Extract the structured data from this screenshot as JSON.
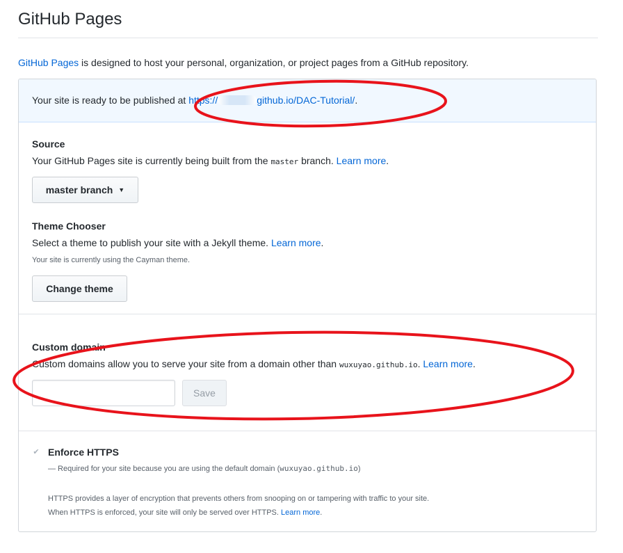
{
  "page": {
    "title": "GitHub Pages",
    "intro_link": "GitHub Pages",
    "intro_text": " is designed to host your personal, organization, or project pages from a GitHub repository."
  },
  "flash": {
    "text": "Your site is ready to be published at ",
    "url_prefix": "https://",
    "url_suffix": "github.io/DAC-Tutorial/",
    "end": "."
  },
  "source": {
    "heading": "Source",
    "desc_prefix": "Your GitHub Pages site is currently being built from the ",
    "branch_code": "master",
    "desc_suffix": " branch. ",
    "learn_more": "Learn more",
    "end": ".",
    "dropdown_label": "master branch"
  },
  "theme": {
    "heading": "Theme Chooser",
    "desc": "Select a theme to publish your site with a Jekyll theme. ",
    "learn_more": "Learn more",
    "end": ".",
    "note_prefix": "Your site is currently using the ",
    "theme_name": "Cayman",
    "note_suffix": " theme.",
    "button_label": "Change theme"
  },
  "domain": {
    "heading": "Custom domain",
    "desc_prefix": "Custom domains allow you to serve your site from a domain other than ",
    "default_domain": "wuxuyao.github.io",
    "desc_suffix": ". ",
    "learn_more": "Learn more",
    "end": ".",
    "input_value": "",
    "input_placeholder": "",
    "save_label": "Save"
  },
  "https": {
    "label": "Enforce HTTPS",
    "note_prefix": "— Required for your site because you are using the default domain (",
    "note_domain": "wuxuyao.github.io",
    "note_suffix": ")",
    "info_line1": "HTTPS provides a layer of encryption that prevents others from snooping on or tampering with traffic to your site.",
    "info_line2": "When HTTPS is enforced, your site will only be served over HTTPS. ",
    "learn_more": "Learn more",
    "end": "."
  },
  "colors": {
    "link": "#0366d6",
    "flash_bg": "#f1f8ff",
    "annotation": "#e8131b"
  },
  "icons": {
    "checkbox": "checkmark-icon",
    "dropdown": "caret-down-icon"
  }
}
